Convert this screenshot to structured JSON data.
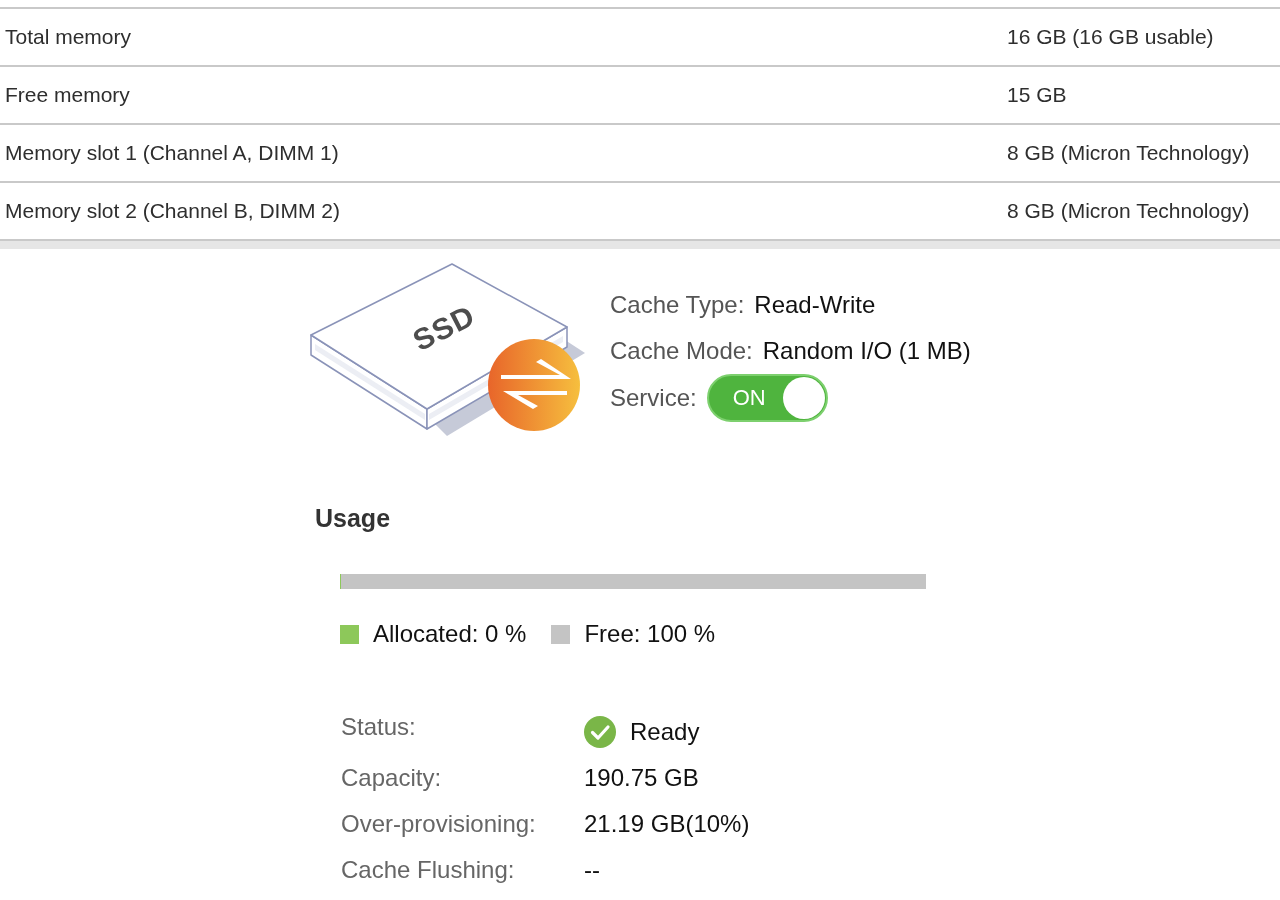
{
  "memory_table": {
    "rows": [
      {
        "label": "Total memory",
        "value": "16 GB (16 GB usable)"
      },
      {
        "label": "Free memory",
        "value": "15 GB"
      },
      {
        "label": "Memory slot 1 (Channel A, DIMM 1)",
        "value": "8 GB (Micron Technology)"
      },
      {
        "label": "Memory slot 2 (Channel B, DIMM 2)",
        "value": "8 GB (Micron Technology)"
      }
    ]
  },
  "cache": {
    "illustration_label": "SSD",
    "details": [
      {
        "kind": "text",
        "label": "Cache Type:",
        "value": "Read-Write"
      },
      {
        "kind": "text",
        "label": "Cache Mode:",
        "value": "Random I/O (1 MB)"
      },
      {
        "kind": "toggle",
        "label": "Service:",
        "toggle": {
          "text": "ON",
          "on": true
        }
      }
    ]
  },
  "usage": {
    "title": "Usage",
    "level": 0,
    "legend": [
      {
        "label": "Allocated: 0 %",
        "color": "#8dc85a"
      },
      {
        "label": "Free: 100 %",
        "color": "#c4c4c4"
      }
    ]
  },
  "details": [
    {
      "kind": "status",
      "label": "Status:",
      "value": "Ready"
    },
    {
      "kind": "text",
      "label": "Capacity:",
      "value": "190.75 GB"
    },
    {
      "kind": "text",
      "label": "Over-provisioning:",
      "value": "21.19 GB(10%)"
    },
    {
      "kind": "text",
      "label": "Cache Flushing:",
      "value": "--"
    }
  ]
}
